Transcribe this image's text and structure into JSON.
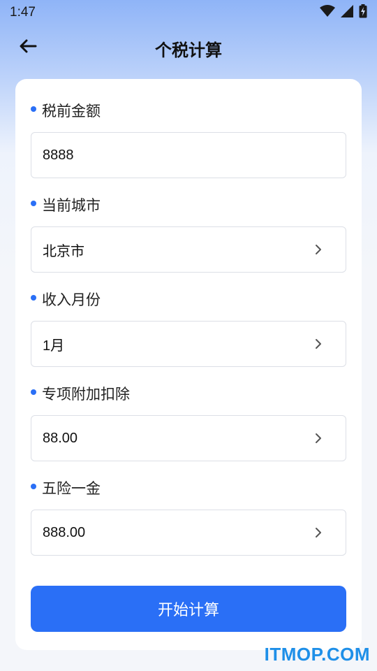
{
  "status_bar": {
    "time": "1:47",
    "icons": [
      "wifi-icon",
      "signal-icon",
      "battery-charging-icon"
    ]
  },
  "header": {
    "back_icon": "arrow-left-icon",
    "title": "个税计算"
  },
  "form": {
    "fields": [
      {
        "label": "税前金额",
        "value": "8888",
        "type": "input"
      },
      {
        "label": "当前城市",
        "value": "北京市",
        "type": "select",
        "icon": "chevron-right-icon"
      },
      {
        "label": "收入月份",
        "value": "1月",
        "type": "select",
        "icon": "chevron-right-icon"
      },
      {
        "label": "专项附加扣除",
        "value": "88.00",
        "type": "select",
        "icon": "chevron-right-icon"
      },
      {
        "label": "五险一金",
        "value": "888.00",
        "type": "select",
        "icon": "chevron-right-icon"
      }
    ],
    "submit_label": "开始计算"
  },
  "watermark": "ITMOP.COM",
  "colors": {
    "accent": "#2a6ff6",
    "watermark": "#1e8fe8"
  }
}
